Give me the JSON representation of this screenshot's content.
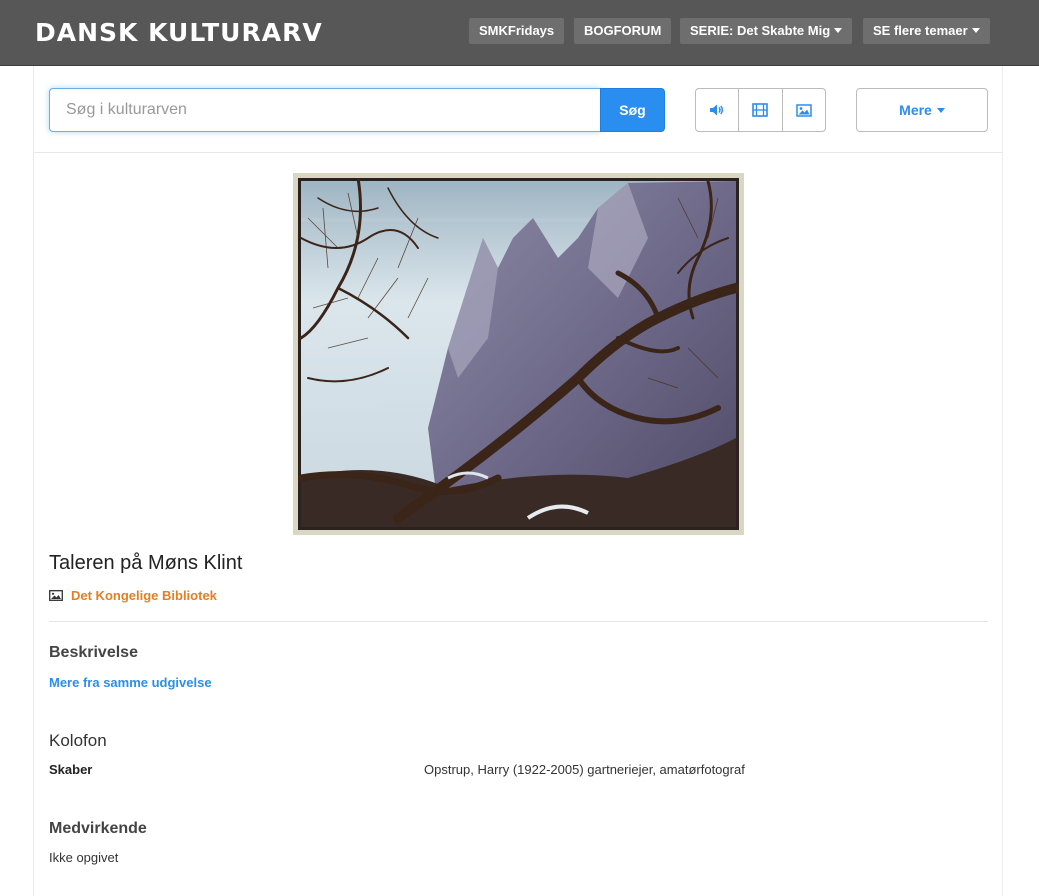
{
  "header": {
    "logo": "DANSK KULTURARV",
    "nav": [
      {
        "label": "SMKFridays"
      },
      {
        "label": "BOGFORUM"
      },
      {
        "label": "SERIE: Det Skabte Mig"
      },
      {
        "label": "SE flere temaer"
      }
    ]
  },
  "search": {
    "placeholder": "Søg i kulturarven",
    "value": "",
    "button_label": "Søg",
    "media_filters": [
      "speaker-icon",
      "film-icon",
      "image-icon"
    ],
    "more_label": "Mere"
  },
  "item": {
    "title": "Taleren på Møns Klint",
    "source_icon": "image-icon",
    "source": "Det Kongelige Bibliotek"
  },
  "sections": {
    "description": {
      "heading": "Beskrivelse",
      "link": "Mere fra samme udgivelse"
    },
    "colophon": {
      "heading": "Kolofon",
      "creator_label": "Skaber",
      "creator_value": "Opstrup, Harry (1922-2005) gartneriejer, amatørfotograf"
    },
    "contributors": {
      "heading": "Medvirkende",
      "value": "Ikke opgivet"
    }
  },
  "colors": {
    "header_bg": "#575757",
    "nav_btn_bg": "#6e6e6e",
    "accent_blue": "#2a8ef0",
    "source_orange": "#e67e22"
  }
}
